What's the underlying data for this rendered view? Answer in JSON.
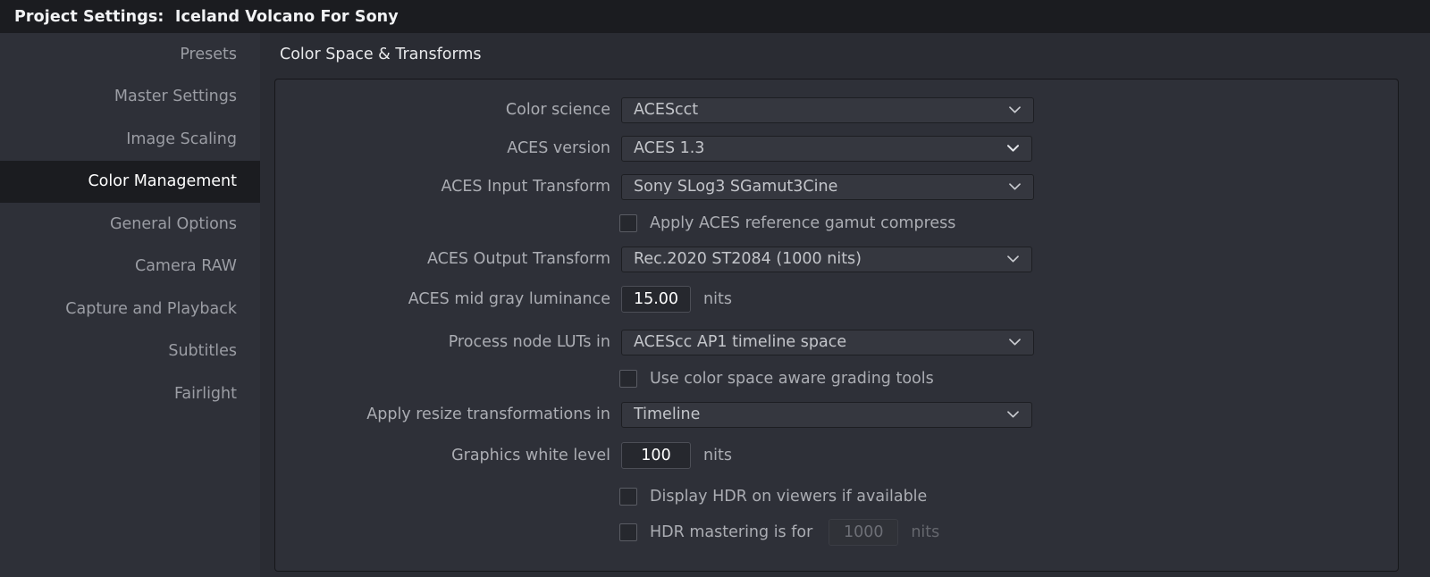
{
  "window": {
    "title": "Project Settings:  Iceland Volcano For Sony"
  },
  "sidebar": {
    "items": [
      {
        "label": "Presets",
        "selected": false
      },
      {
        "label": "Master Settings",
        "selected": false
      },
      {
        "label": "Image Scaling",
        "selected": false
      },
      {
        "label": "Color Management",
        "selected": true
      },
      {
        "label": "General Options",
        "selected": false
      },
      {
        "label": "Camera RAW",
        "selected": false
      },
      {
        "label": "Capture and Playback",
        "selected": false
      },
      {
        "label": "Subtitles",
        "selected": false
      },
      {
        "label": "Fairlight",
        "selected": false
      }
    ]
  },
  "main": {
    "section_title": "Color Space & Transforms",
    "rows": {
      "color_science": {
        "label": "Color science",
        "value": "ACEScct",
        "icon": "chevron-down-icon"
      },
      "aces_version": {
        "label": "ACES version",
        "value": "ACES 1.3",
        "icon": "chevron-down-icon"
      },
      "aces_input_transform": {
        "label": "ACES Input Transform",
        "value": "Sony SLog3 SGamut3Cine",
        "icon": "chevron-down-icon"
      },
      "apply_gamut_compress": {
        "label": "Apply ACES reference gamut compress",
        "checked": false
      },
      "aces_output_transform": {
        "label": "ACES Output Transform",
        "value": "Rec.2020 ST2084 (1000 nits)",
        "icon": "chevron-down-icon"
      },
      "aces_mid_gray": {
        "label": "ACES mid gray luminance",
        "value": "15.00",
        "unit": "nits"
      },
      "process_node_luts": {
        "label": "Process node LUTs in",
        "value": "ACEScc AP1 timeline space",
        "icon": "chevron-down-icon"
      },
      "color_space_aware": {
        "label": "Use color space aware grading tools",
        "checked": false
      },
      "apply_resize": {
        "label": "Apply resize transformations in",
        "value": "Timeline",
        "icon": "chevron-down-icon"
      },
      "graphics_white_level": {
        "label": "Graphics white level",
        "value": "100",
        "unit": "nits"
      },
      "display_hdr": {
        "label": "Display HDR on viewers if available",
        "checked": false
      },
      "hdr_mastering": {
        "label": "HDR mastering is for",
        "checked": false,
        "value": "1000",
        "unit": "nits"
      }
    }
  },
  "colors": {
    "titlebar_bg": "#1b1c20",
    "sidebar_bg": "#2e3038",
    "selected_bg": "#1b1c20",
    "content_bg": "#2a2c33",
    "panel_bg": "#2e3038",
    "field_bg": "#35373f",
    "text": "#abadb3",
    "text_bright": "#ffffff"
  }
}
